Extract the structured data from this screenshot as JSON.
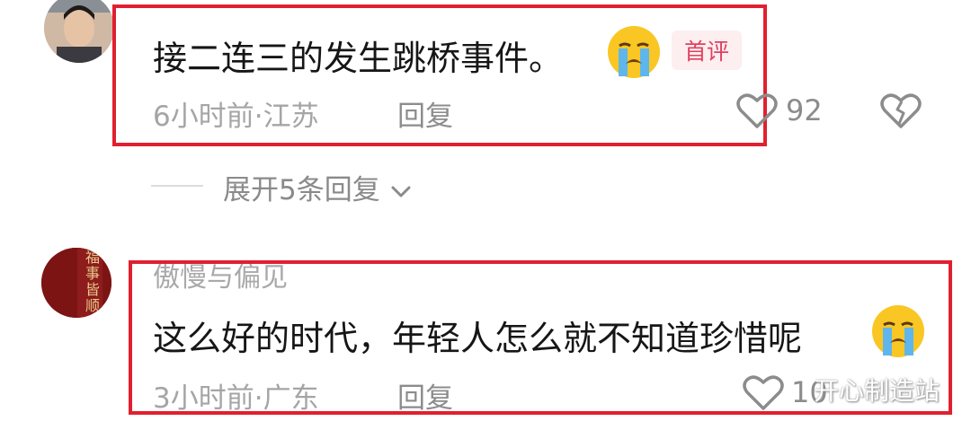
{
  "comments": [
    {
      "username": "",
      "text": "接二连三的发生跳桥事件。",
      "emoji": "loudly-crying-face",
      "badge": "首评",
      "time": "6小时前",
      "dot": "·",
      "location": "江苏",
      "reply": "回复",
      "likes": "92",
      "expand": "展开5条回复"
    },
    {
      "username": "傲慢与偏见",
      "text": "这么好的时代，年轻人怎么就不知道珍惜呢",
      "emoji": "loudly-crying-face",
      "time": "3小时前",
      "dot": "·",
      "location": "广东",
      "reply": "回复",
      "likes": "10"
    }
  ],
  "avatar2_text": [
    "福",
    "事",
    "皆",
    "顺"
  ],
  "watermark": "开心制造站",
  "colors": {
    "highlight_box": "#e0202f",
    "badge_text": "#e0405e",
    "badge_bg": "#fdeef0",
    "meta_text": "#a5a5a5"
  }
}
